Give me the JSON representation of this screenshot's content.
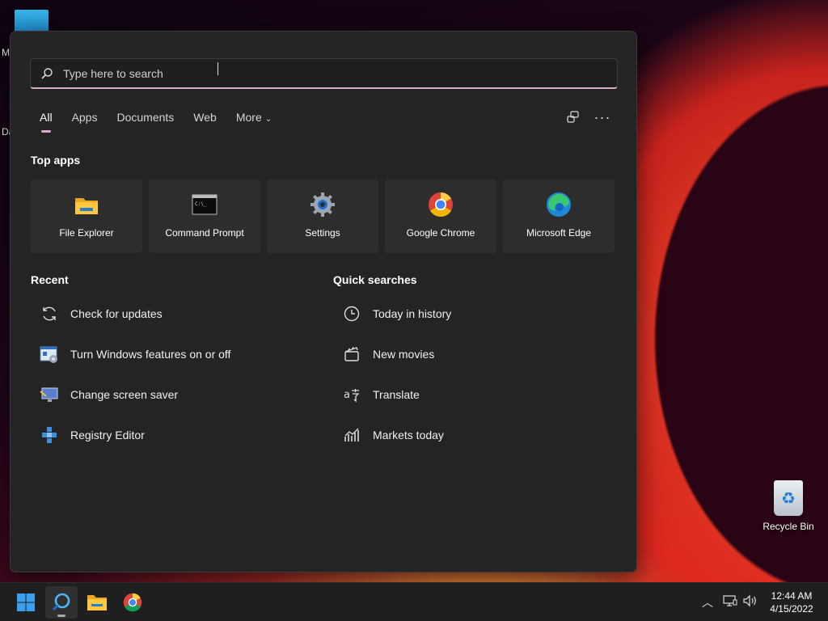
{
  "desktop": {
    "edge_letters": [
      "M",
      "Da"
    ],
    "recycle_bin_label": "Recycle Bin"
  },
  "search": {
    "placeholder": "Type here to search",
    "value": ""
  },
  "tabs": [
    {
      "label": "All",
      "active": true
    },
    {
      "label": "Apps"
    },
    {
      "label": "Documents"
    },
    {
      "label": "Web"
    },
    {
      "label": "More"
    }
  ],
  "toolbar": {
    "connect_icon": "share-icon",
    "more_icon": "ellipsis-icon"
  },
  "top_apps": {
    "title": "Top apps",
    "items": [
      {
        "label": "File Explorer",
        "icon": "folder-icon"
      },
      {
        "label": "Command Prompt",
        "icon": "terminal-icon"
      },
      {
        "label": "Settings",
        "icon": "gear-icon"
      },
      {
        "label": "Google Chrome",
        "icon": "chrome-icon"
      },
      {
        "label": "Microsoft Edge",
        "icon": "edge-icon"
      }
    ]
  },
  "recent": {
    "title": "Recent",
    "items": [
      {
        "label": "Check for updates",
        "icon": "refresh-icon"
      },
      {
        "label": "Turn Windows features on or off",
        "icon": "windows-features-icon"
      },
      {
        "label": "Change screen saver",
        "icon": "monitor-icon"
      },
      {
        "label": "Registry Editor",
        "icon": "registry-icon"
      }
    ]
  },
  "quick_searches": {
    "title": "Quick searches",
    "items": [
      {
        "label": "Today in history",
        "icon": "clock-icon"
      },
      {
        "label": "New movies",
        "icon": "clapperboard-icon"
      },
      {
        "label": "Translate",
        "icon": "translate-icon"
      },
      {
        "label": "Markets today",
        "icon": "chart-icon"
      }
    ]
  },
  "taskbar": {
    "clock_time": "12:44 AM",
    "clock_date": "4/15/2022"
  },
  "colors": {
    "accent": "#e0a7cf",
    "panel_bg": "#242424",
    "tile_bg": "#2d2d2d"
  }
}
